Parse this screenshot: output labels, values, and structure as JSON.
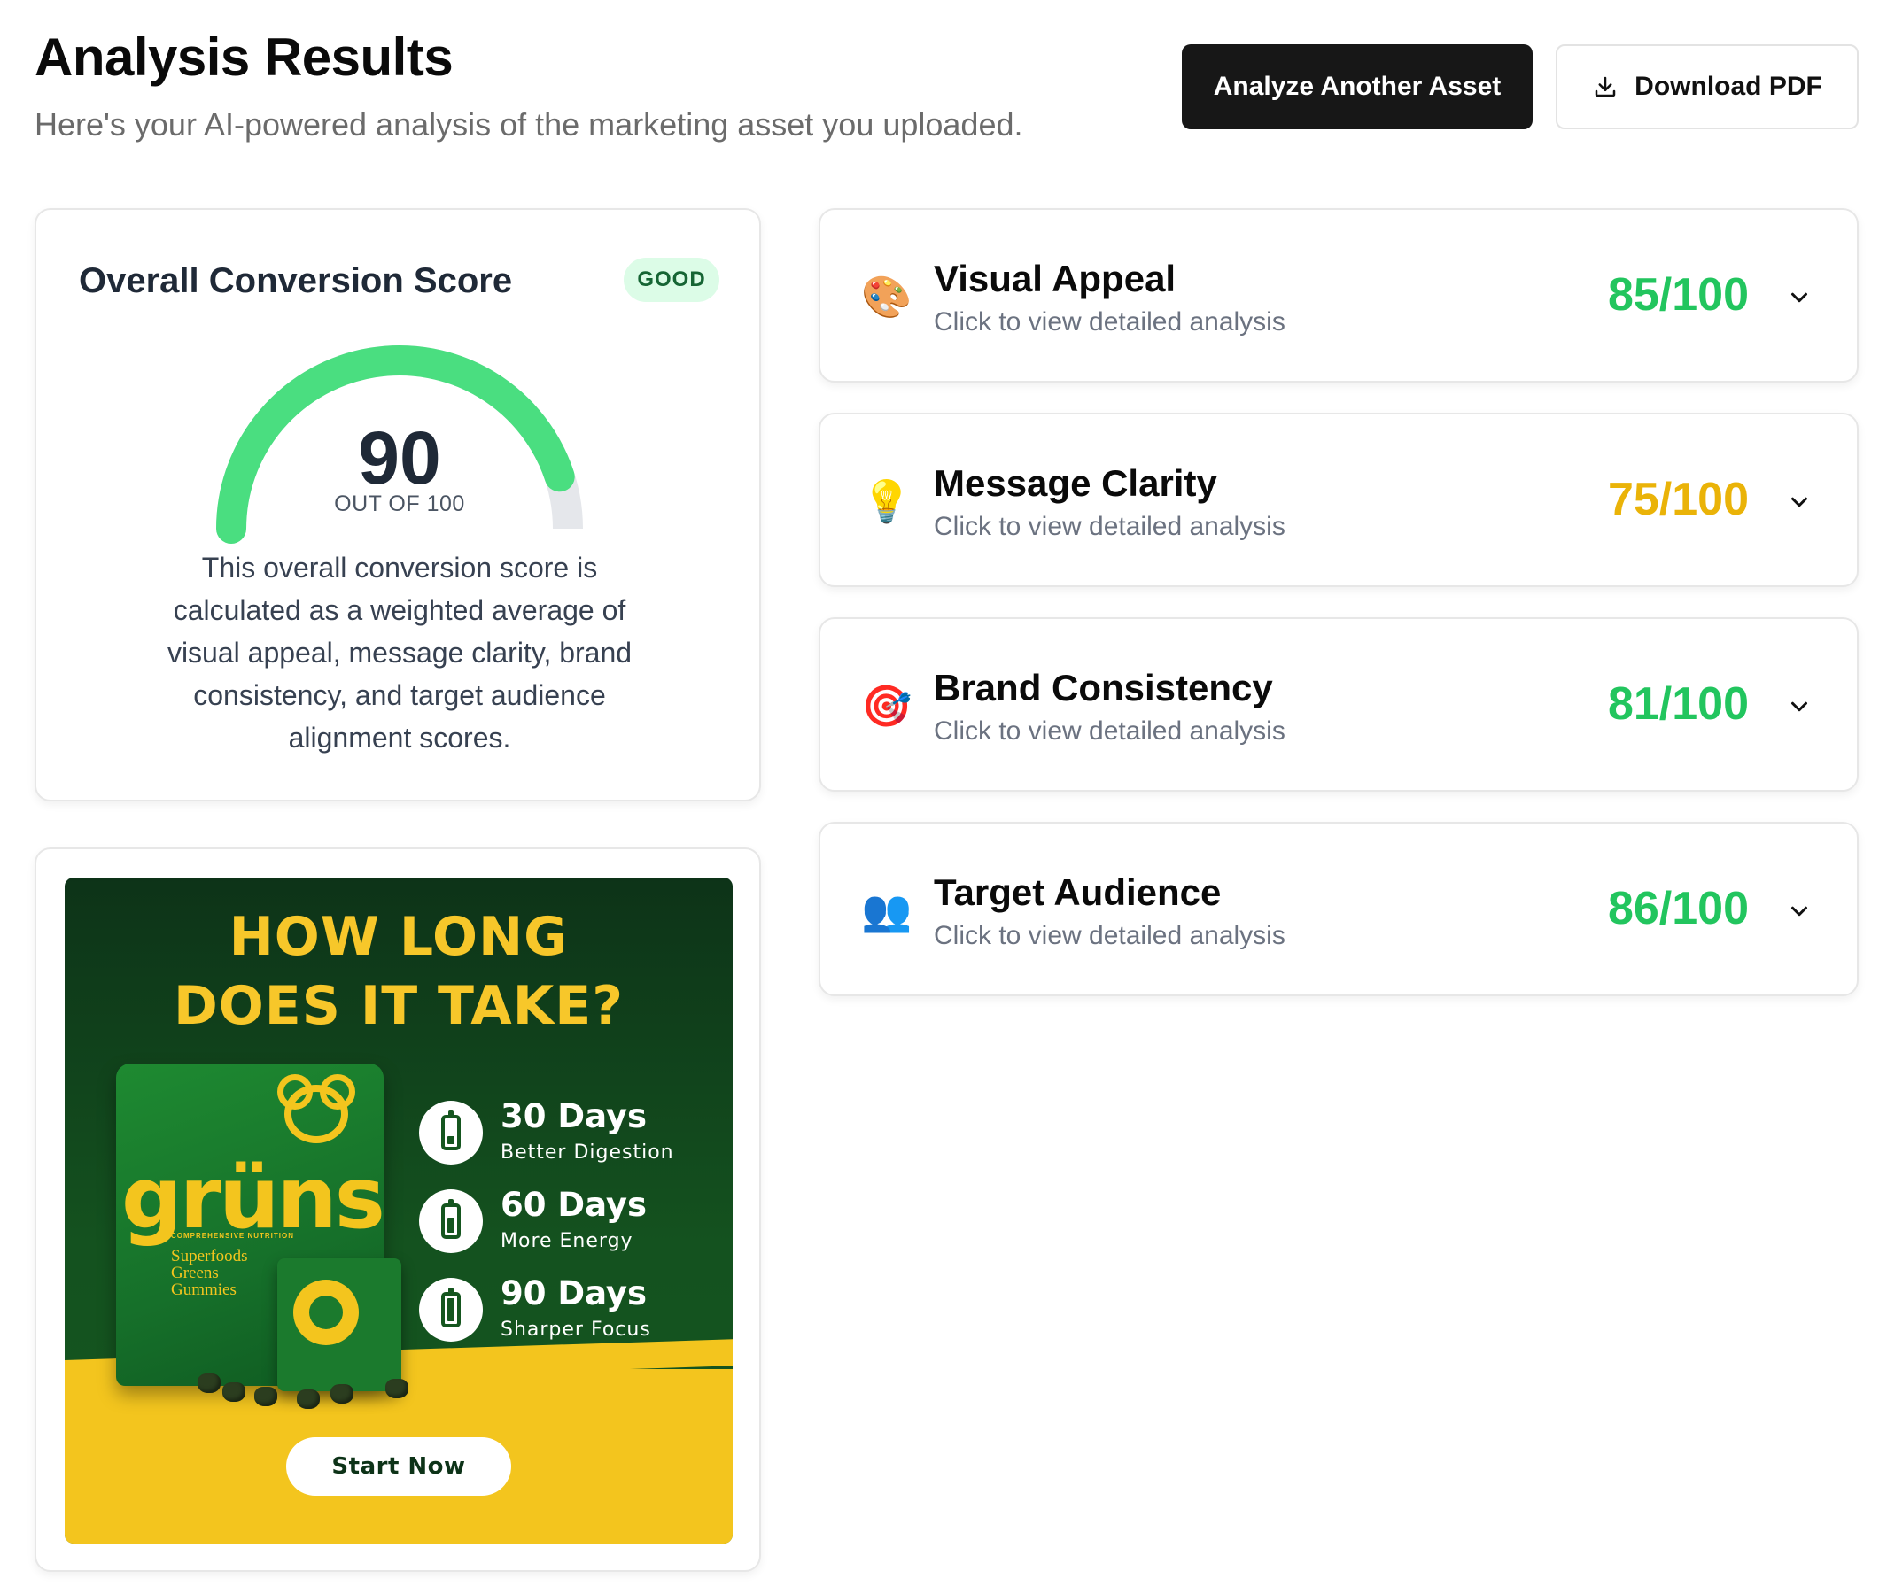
{
  "header": {
    "title": "Analysis Results",
    "subtitle": "Here's your AI-powered analysis of the marketing asset you uploaded.",
    "analyze_another_label": "Analyze Another Asset",
    "download_pdf_label": "Download PDF"
  },
  "overall": {
    "title": "Overall Conversion Score",
    "badge": "GOOD",
    "score": "90",
    "score_value": 90,
    "score_max": 100,
    "out_of_label": "OUT OF 100",
    "description": "This overall conversion score is calculated as a weighted average of visual appeal, message clarity, brand consistency, and target audience alignment scores.",
    "accent_color": "#4ade80",
    "track_color": "#e5e7eb"
  },
  "asset": {
    "headline_line1": "HOW LONG",
    "headline_line2": "DOES IT TAKE?",
    "brand": "grüns",
    "product_small_label": "COMPREHENSIVE NUTRITION",
    "product_line1": "Superfoods",
    "product_line2": "Greens",
    "product_line3": "Gummies",
    "timeline": [
      {
        "days": "30 Days",
        "benefit": "Better Digestion",
        "fill": 0.33
      },
      {
        "days": "60 Days",
        "benefit": "More Energy",
        "fill": 0.66
      },
      {
        "days": "90 Days",
        "benefit": "Sharper Focus",
        "fill": 1.0
      }
    ],
    "cta": "Start Now",
    "colors": {
      "green": "#15561f",
      "yellow": "#f3c51e"
    }
  },
  "metrics": [
    {
      "icon": "palette-icon",
      "emoji": "🎨",
      "title": "Visual Appeal",
      "subtitle": "Click to view detailed analysis",
      "score": "85/100",
      "color": "#22c55e"
    },
    {
      "icon": "lightbulb-icon",
      "emoji": "💡",
      "title": "Message Clarity",
      "subtitle": "Click to view detailed analysis",
      "score": "75/100",
      "color": "#eab308"
    },
    {
      "icon": "target-icon",
      "emoji": "🎯",
      "title": "Brand Consistency",
      "subtitle": "Click to view detailed analysis",
      "score": "81/100",
      "color": "#22c55e"
    },
    {
      "icon": "people-icon",
      "emoji": "👥",
      "title": "Target Audience",
      "subtitle": "Click to view detailed analysis",
      "score": "86/100",
      "color": "#22c55e"
    }
  ]
}
